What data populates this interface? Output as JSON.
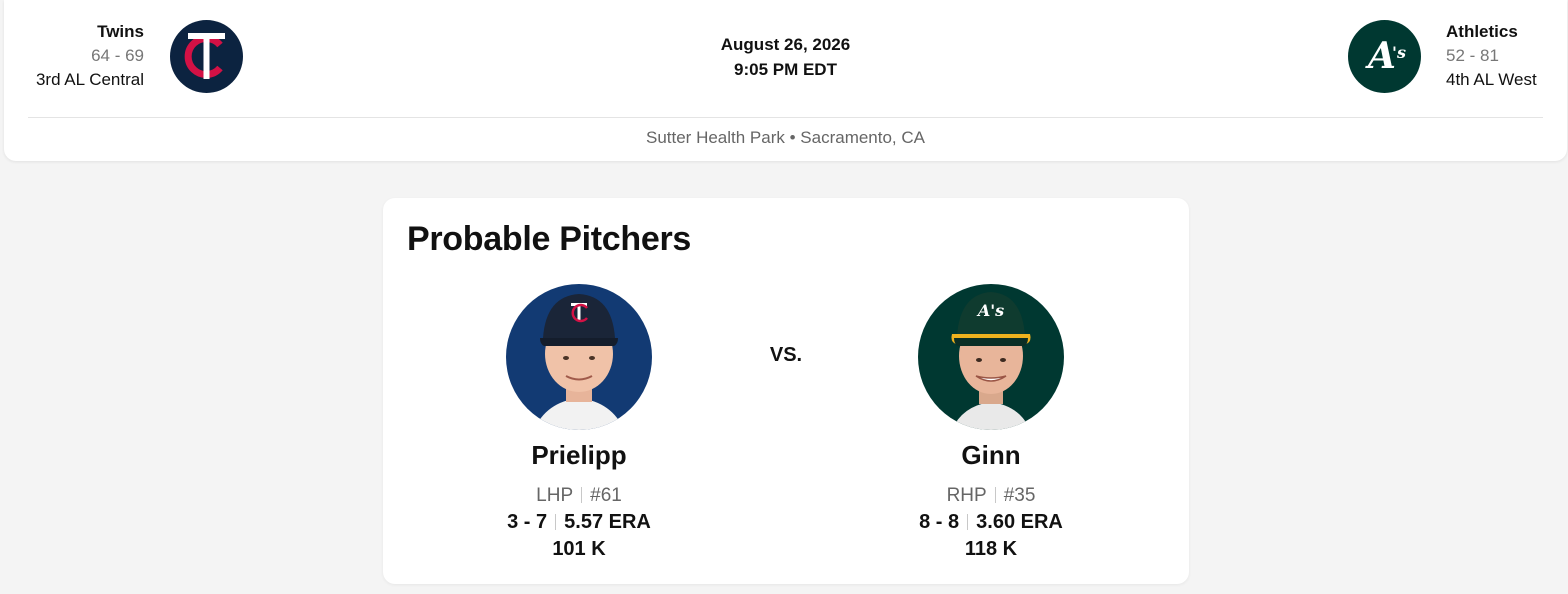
{
  "game": {
    "date": "August 26, 2026",
    "time": "9:05 PM EDT",
    "venue": "Sutter Health Park • Sacramento, CA"
  },
  "away_team": {
    "name": "Twins",
    "record": "64 - 69",
    "standing": "3rd AL Central",
    "logo_icon": "twins-logo-icon",
    "color": "#0c2340",
    "accent": "#d31145"
  },
  "home_team": {
    "name": "Athletics",
    "record": "52 - 81",
    "standing": "4th AL West",
    "logo_icon": "athletics-logo-icon",
    "color": "#003831",
    "accent": "#efb21e"
  },
  "probable_pitchers": {
    "title": "Probable Pitchers",
    "vs_label": "VS.",
    "away": {
      "name": "Prielipp",
      "hand": "LHP",
      "number": "#61",
      "record": "3 - 7",
      "era": "5.57 ERA",
      "strikeouts": "101 K"
    },
    "home": {
      "name": "Ginn",
      "hand": "RHP",
      "number": "#35",
      "record": "8 - 8",
      "era": "3.60 ERA",
      "strikeouts": "118 K"
    }
  }
}
